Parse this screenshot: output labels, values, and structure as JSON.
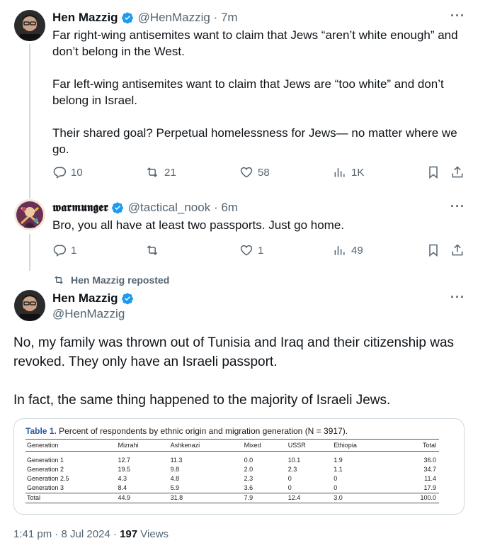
{
  "tweet1": {
    "name": "Hen Mazzig",
    "handle": "@HenMazzig",
    "time": "7m",
    "text": "Far right-wing antisemites want to claim that Jews “aren’t white enough” and don’t belong in the West.\n\nFar left-wing antisemites want to claim that Jews are “too white” and don’t belong in Israel.\n\nTheir shared goal? Perpetual homelessness for Jews— no matter where we go.",
    "replies": "10",
    "reposts": "21",
    "likes": "58",
    "views": "1K"
  },
  "tweet2": {
    "name": "𝖜𝖆𝖗𝖒𝖚𝖓𝖌𝖊𝖗",
    "handle": "@tactical_nook",
    "time": "6m",
    "text": "Bro, you all have at least two passports. Just go home.",
    "replies": "1",
    "reposts": "",
    "likes": "1",
    "views": "49"
  },
  "repost_label": "Hen Mazzig reposted",
  "main_tweet": {
    "name": "Hen Mazzig",
    "handle": "@HenMazzig",
    "text_p1": "No, my family was thrown out of Tunisia and Iraq and their citizenship was revoked. They only have an Israeli passport.",
    "text_p2": "In fact, the same thing happened to the majority of Israeli Jews.",
    "footer_time": "1:41 pm · 8 Jul 2024 · ",
    "footer_views": "197",
    "footer_views_label": " Views"
  },
  "table_image": {
    "caption_label": "Table 1.",
    "caption_text": "Percent of respondents by ethnic origin and migration generation (N = 3917).",
    "headers": [
      "Generation",
      "Mizrahi",
      "Ashkenazi",
      "Mixed",
      "USSR",
      "Ethiopia",
      "Total"
    ],
    "rows": [
      [
        "Generation 1",
        "12.7",
        "11.3",
        "0.0",
        "10.1",
        "1.9",
        "36.0"
      ],
      [
        "Generation 2",
        "19.5",
        "9.8",
        "2.0",
        "2.3",
        "1.1",
        "34.7"
      ],
      [
        "Generation 2.5",
        "4.3",
        "4.8",
        "2.3",
        "0",
        "0",
        "11.4"
      ],
      [
        "Generation 3",
        "8.4",
        "5.9",
        "3.6",
        "0",
        "0",
        "17.9"
      ]
    ],
    "total_row": [
      "Total",
      "44.9",
      "31.8",
      "7.9",
      "12.4",
      "3.0",
      "100.0"
    ]
  },
  "colors": {
    "verified": "#1d9bf0",
    "muted": "#536471",
    "thread_line": "#cfd9de",
    "caption_accent": "#2a5aa8"
  },
  "icons": {
    "verified": "verified-badge-icon",
    "more": "more-icon",
    "reply": "reply-icon",
    "repost": "repost-icon",
    "like": "heart-icon",
    "views": "views-icon",
    "bookmark": "bookmark-icon",
    "share": "share-icon"
  }
}
